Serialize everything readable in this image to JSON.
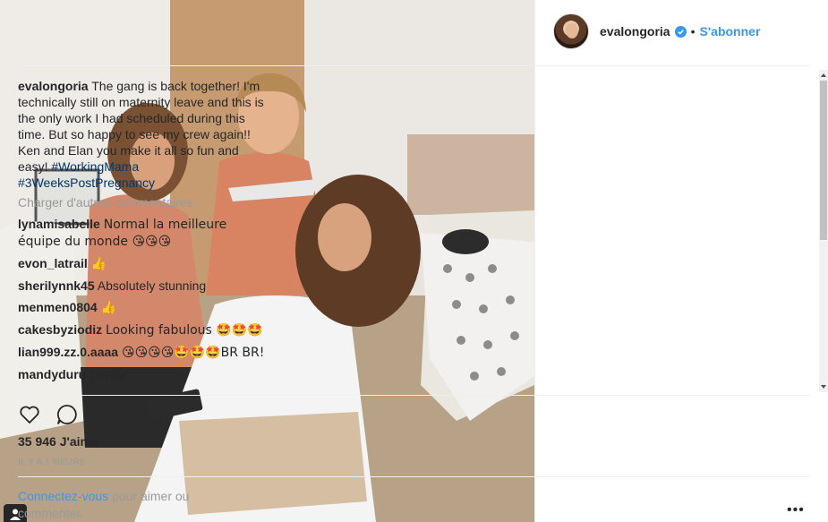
{
  "post": {
    "username": "evalongoria",
    "follow_label": "S'abonner",
    "dot": "•",
    "caption_text": "The gang is back together! I'm technically still on maternity leave and this is the only work I had scheduled during this time. But so happy to see my crew again!! Ken and Elan you make it all so fun and easy!",
    "hashtags": [
      "#WorkingMama",
      "#3WeeksPostPregnancy"
    ],
    "load_more": "Charger d'autres commentaires",
    "likes": "35 946 J'aime",
    "time": "IL Y A 1 HEURE",
    "login_link": "Connectez-vous",
    "login_text": " pour aimer ou commenter.",
    "more_label": "•••"
  },
  "comments": [
    {
      "user": "lynamisabelle",
      "text": "Normal la meilleure équipe du monde 😘😘😘"
    },
    {
      "user": "evon_latrail",
      "text": "👍"
    },
    {
      "user": "sherilynnk45",
      "text": "Absolutely stunning"
    },
    {
      "user": "menmen0804",
      "text": "👍"
    },
    {
      "user": "cakesbyziodiz",
      "text": "Looking fabulous 🤩🤩🤩"
    },
    {
      "user": "lian999.zz.0.aaaa",
      "text": "😘😘😘😘🤩🤩🤩BR BR!"
    },
    {
      "user": "mandyduru",
      "text": "Lovely"
    }
  ],
  "icons": {
    "verified": "verified-badge-icon",
    "like": "heart-icon",
    "comment": "comment-bubble-icon",
    "photo_corner": "user-tag-icon"
  },
  "colors": {
    "link_blue": "#3897f0",
    "hashtag": "#003569",
    "muted": "#999999",
    "text": "#262626"
  }
}
